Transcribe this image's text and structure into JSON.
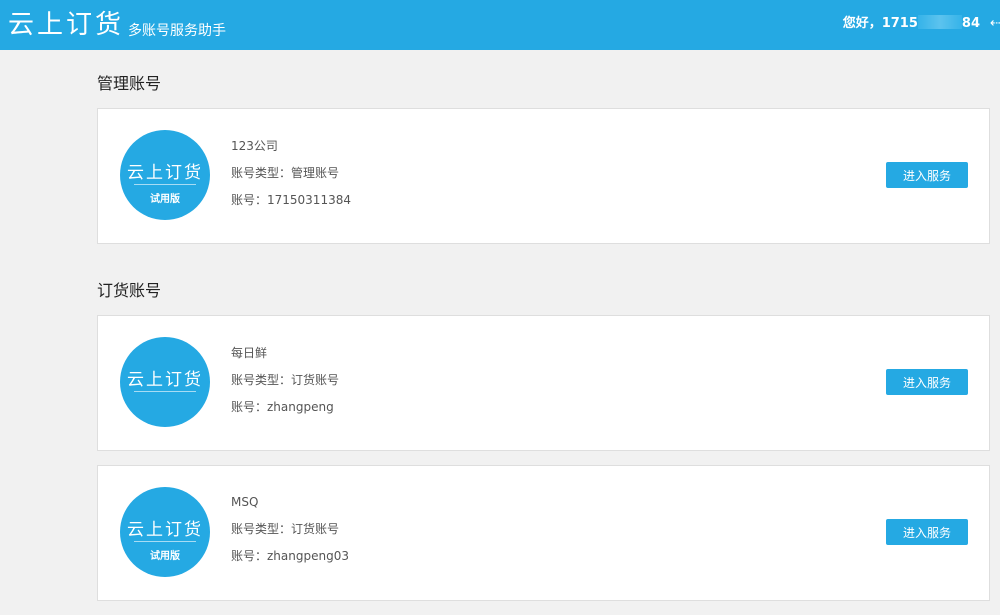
{
  "header": {
    "brand": "云上订货",
    "subtitle": "多账号服务助手",
    "greeting_prefix": "您好，1715",
    "greeting_suffix": "84",
    "logout_icon": "logout-arrow-icon"
  },
  "sections": [
    {
      "title": "管理账号",
      "cards": [
        {
          "logo_text": "云上订货",
          "trial_label": "试用版",
          "company": "123公司",
          "type_line": "账号类型：管理账号",
          "account_line": "账号：17150311384",
          "button": "进入服务"
        }
      ]
    },
    {
      "title": "订货账号",
      "cards": [
        {
          "logo_text": "云上订货",
          "trial_label": "",
          "company": "每日鲜",
          "type_line": "账号类型：订货账号",
          "account_line": "账号：zhangpeng",
          "button": "进入服务"
        },
        {
          "logo_text": "云上订货",
          "trial_label": "试用版",
          "company": "MSQ",
          "type_line": "账号类型：订货账号",
          "account_line": "账号：zhangpeng03",
          "button": "进入服务"
        }
      ]
    }
  ],
  "colors": {
    "accent": "#25a9e3",
    "background": "#f1f1f1"
  }
}
